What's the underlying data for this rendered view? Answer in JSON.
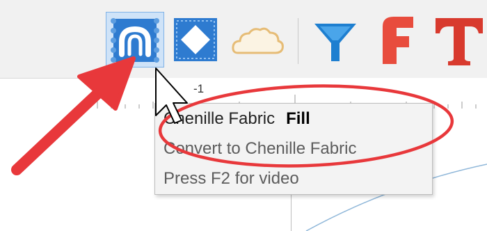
{
  "toolbar": {
    "buttons": [
      {
        "name": "chenille-fabric-fill",
        "icon": "chenille-fabric-icon",
        "active": true,
        "color": "#2e7bd0"
      },
      {
        "name": "diamond-fill",
        "icon": "diamond-pattern-icon",
        "active": false,
        "color": "#2e7bd0"
      },
      {
        "name": "cloud",
        "icon": "cloud-icon",
        "active": false,
        "color": "#e8c07a"
      },
      {
        "name": "filter",
        "icon": "funnel-icon",
        "active": false,
        "color": "#1e7fd0"
      },
      {
        "name": "font-f",
        "icon": "letter-f-icon",
        "active": false,
        "color": "#e84c3d"
      },
      {
        "name": "text-t",
        "icon": "letter-t-icon",
        "active": false,
        "color": "#d83a2e"
      }
    ]
  },
  "ruler": {
    "label": "-1"
  },
  "tooltip": {
    "title": "Chenille Fabric",
    "title_emphasis": "Fill",
    "description": "Convert to Chenille Fabric",
    "hint": "Press F2 for video"
  },
  "annotation": {
    "color": "#e8383b"
  }
}
